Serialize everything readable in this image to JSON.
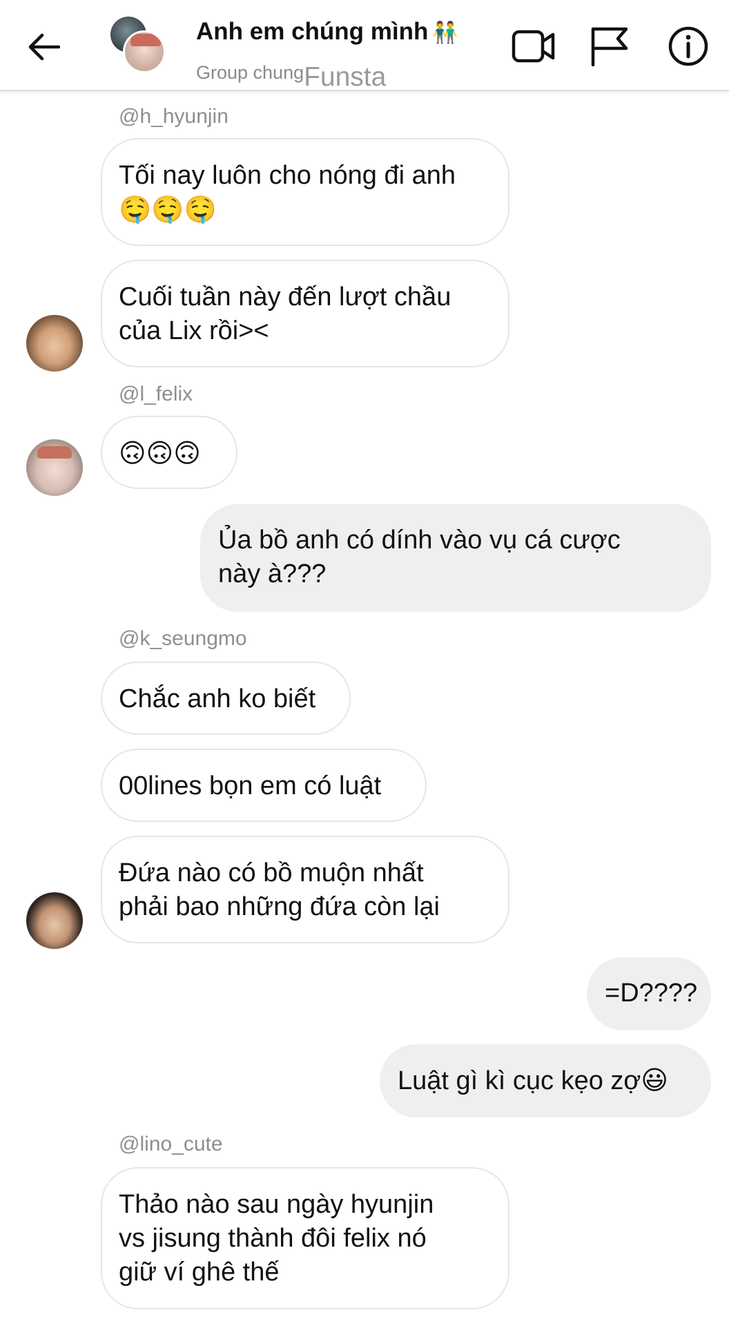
{
  "header": {
    "title": "Anh em chúng mình",
    "title_emoji": "👬",
    "subtitle": "Group chung",
    "watermark": "Funsta",
    "icons": [
      "back-arrow-icon",
      "video-call-icon",
      "flag-icon",
      "info-icon"
    ]
  },
  "messages": {
    "m1_sender": "@h_hyunjin",
    "m1_text": "Tối nay luôn cho nóng đi anh",
    "m1_emoji": "🤤🤤🤤",
    "m2_text_line1": "Cuối tuần này đến lượt chầu",
    "m2_text_line2": "của Lix rồi><",
    "m3_sender": "@l_felix",
    "m3_emoji": "🙃🙃🙃",
    "m4_text_line1": "Ủa bồ anh có dính vào vụ cá cược",
    "m4_text_line2": "này à???",
    "m5_sender": "@k_seungmo",
    "m5_text": "Chắc anh ko biết",
    "m6_text": "00lines bọn em có luật",
    "m7_text_line1": "Đứa nào có bồ muộn nhất",
    "m7_text_line2": "phải bao những đứa còn lại",
    "m8_text": "=D????",
    "m9_text": "Luật gì kì cục kẹo zợ",
    "m9_emoji": "😃",
    "m10_sender": "@lino_cute",
    "m10_text_line1": "Thảo nào sau ngày hyunjin",
    "m10_text_line2": "vs jisung thành đôi felix nó",
    "m10_text_line3": "giữ ví ghê thế"
  },
  "colors": {
    "incoming_bubble_border": "#e6e6e6",
    "outgoing_bubble_bg": "#efefef",
    "username_gray": "#8e8e8e",
    "subtitle_gray": "#8a8a8a"
  }
}
